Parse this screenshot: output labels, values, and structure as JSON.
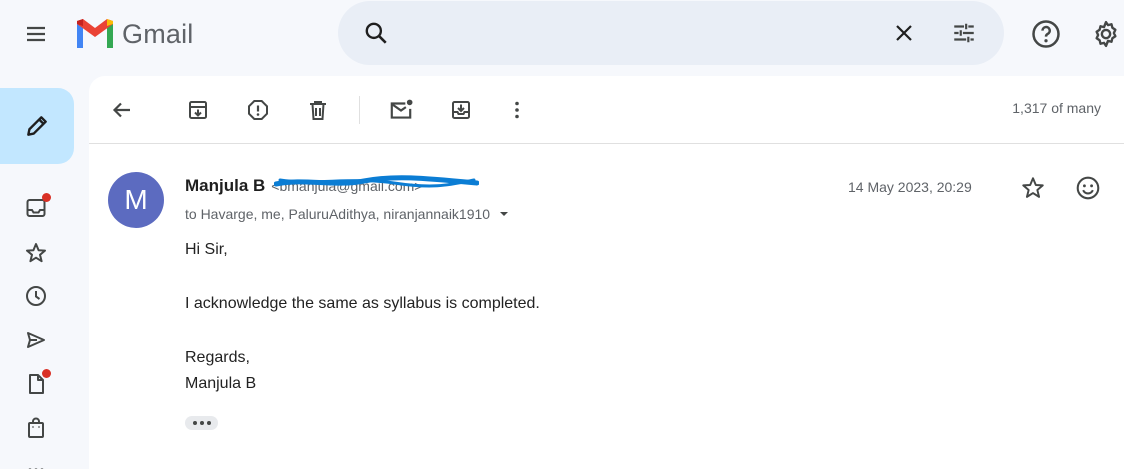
{
  "app": {
    "logo_text": "Gmail",
    "brand_colors": {
      "red": "#ea4335",
      "blue": "#4285f4",
      "green": "#34a853",
      "yellow": "#fbbc04",
      "dark_red": "#c5221f"
    }
  },
  "header": {
    "menu_icon": "hamburger-menu-icon",
    "search": {
      "placeholder": "",
      "value": "",
      "icons": [
        "search-icon",
        "clear-icon",
        "filter-options-icon"
      ]
    },
    "right_icons": [
      "help-icon",
      "settings-icon"
    ]
  },
  "rail": {
    "compose_icon": "pencil-icon",
    "items": [
      {
        "icon": "inbox-icon",
        "badge": true
      },
      {
        "icon": "star-icon",
        "badge": false
      },
      {
        "icon": "clock-icon",
        "badge": false
      },
      {
        "icon": "send-icon",
        "badge": false
      },
      {
        "icon": "draft-icon",
        "badge": true
      },
      {
        "icon": "shopping-bag-icon",
        "badge": false
      }
    ],
    "badge_color": "#d93025"
  },
  "toolbar": {
    "icons": [
      "back-arrow-icon",
      "archive-icon",
      "report-spam-icon",
      "delete-icon",
      "mark-unread-icon",
      "move-to-icon",
      "more-vertical-icon"
    ],
    "pager": "1,317 of many"
  },
  "message": {
    "avatar_letter": "M",
    "avatar_color": "#5c6bc0",
    "sender_name": "Manjula B",
    "sender_email": "<bmanjula@gmail.com>",
    "recipients": "to Havarge, me, PaluruAdithya, niranjannaik1910",
    "date": "14 May 2023, 20:29",
    "header_icons": [
      "star-icon",
      "emoji-react-icon"
    ],
    "body": {
      "greeting": "Hi Sir,",
      "paragraph": "I acknowledge the same as syllabus is completed.",
      "closing": "Regards,",
      "signature": "Manjula B"
    },
    "redaction_color": "#0b7dd4"
  }
}
